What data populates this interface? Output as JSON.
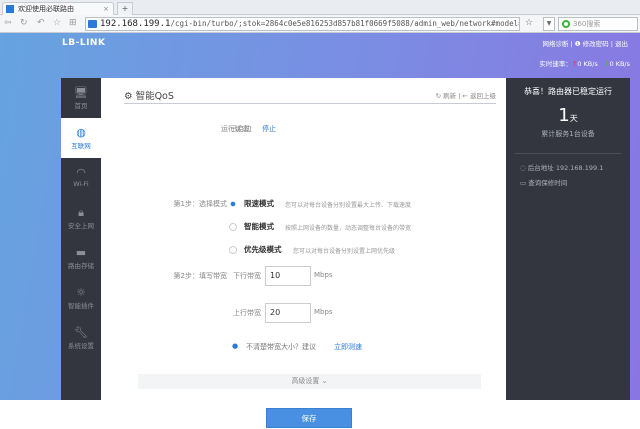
{
  "browser": {
    "tab_title": "欢迎使用必联路由",
    "new_tab": "+",
    "url_host": "192.168.199.1",
    "url_path": "/cgi-bin/turbo/;stok=2864c0e5e816253d857b81f0669f5088/admin_web/network#model=",
    "search_placeholder": "360搜索"
  },
  "header": {
    "logo": "LB-LINK",
    "links": [
      "网络诊断",
      "修改密码",
      "退出"
    ],
    "speed_label": "实时速率：",
    "upload": "0 KB/s",
    "download": "0 KB/s"
  },
  "sidebar": {
    "items": [
      {
        "label": "首页",
        "icon": "monitor-icon"
      },
      {
        "label": "互联网",
        "icon": "globe-icon",
        "active": true
      },
      {
        "label": "Wi-Fi",
        "icon": "wifi-icon"
      },
      {
        "label": "安全上网",
        "icon": "lock-icon"
      },
      {
        "label": "路由存储",
        "icon": "folder-icon"
      },
      {
        "label": "智能插件",
        "icon": "sun-icon"
      },
      {
        "label": "系统设置",
        "icon": "wrench-icon"
      }
    ]
  },
  "main": {
    "title": "智能QoS",
    "refresh": "刷新",
    "back": "返回上级",
    "status_label": "运行状态：",
    "status_value": "已启动",
    "stop": "停止",
    "step1_label": "第1步：选择模式",
    "modes": [
      {
        "name": "限速模式",
        "desc": "您可以对每台设备分别设置最大上传、下载速度",
        "selected": true
      },
      {
        "name": "智能模式",
        "desc": "按照上网设备的数量，动态调整每台设备的带宽",
        "selected": false
      },
      {
        "name": "优先级模式",
        "desc": "您可以对每台设备分别设置上网优先级",
        "selected": false
      }
    ],
    "step2_label": "第2步：填写带宽",
    "down_label": "下行带宽",
    "down_value": "10",
    "up_label": "上行带宽",
    "up_value": "20",
    "unit": "Mbps",
    "hint": "不清楚带宽大小？建议",
    "speedtest": "立即测速",
    "advanced": "高级设置",
    "save": "保存"
  },
  "right": {
    "title": "恭喜！路由器已稳定运行",
    "days": "1",
    "days_unit": "天",
    "devices": "累计服务1台设备",
    "admin_addr": "后台地址 192.168.199.1",
    "warranty": "查询保修时间"
  },
  "colors": {
    "accent": "#2b79d8",
    "sidebar": "#33363f",
    "save": "#4a90e2"
  }
}
